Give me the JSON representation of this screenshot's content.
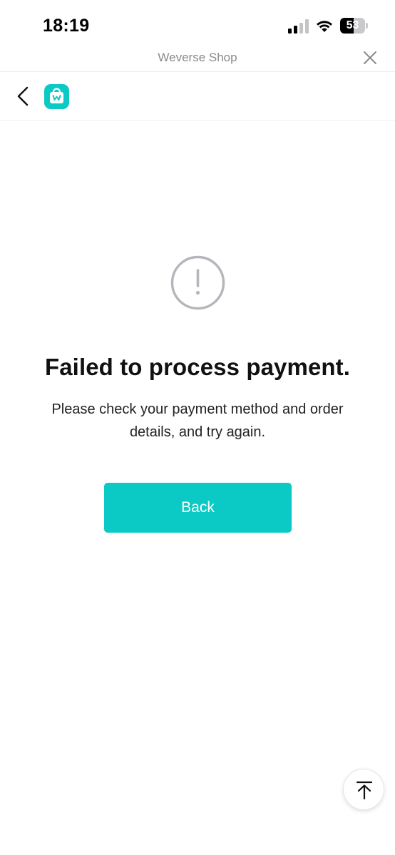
{
  "status_bar": {
    "time": "18:19",
    "battery_level": "53",
    "battery_fraction": 0.53,
    "icons": [
      "signal-icon",
      "wifi-icon",
      "battery-icon"
    ]
  },
  "webview": {
    "title": "Weverse Shop",
    "close_icon": "close-icon"
  },
  "nav": {
    "back_icon": "back-arrow-icon",
    "logo_icon": "weverse-shop-logo-icon"
  },
  "error": {
    "icon": "exclamation-circle-icon",
    "title": "Failed to process payment.",
    "message": "Please check your payment method and order details, and try again.",
    "button_label": "Back"
  },
  "scroll_top": {
    "icon": "arrow-up-to-top-icon"
  },
  "colors": {
    "accent": "#0BCAC6",
    "icon_gray": "#B5B5BB",
    "title_gray": "#8A8A8A"
  }
}
